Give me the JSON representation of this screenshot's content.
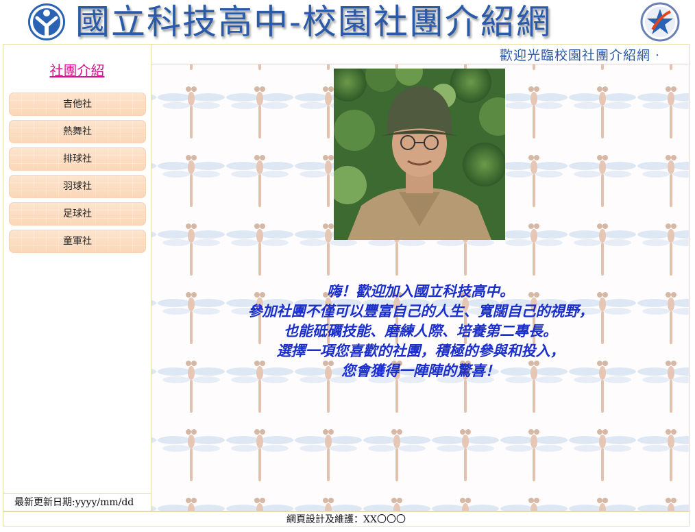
{
  "header": {
    "title": "國立科技高中-校園社團介紹網"
  },
  "welcome": {
    "marquee": "歡迎光臨校園社團介紹網 ·"
  },
  "sidebar": {
    "title": "社團介紹",
    "clubs": [
      {
        "label": "吉他社"
      },
      {
        "label": "熱舞社"
      },
      {
        "label": "排球社"
      },
      {
        "label": "羽球社"
      },
      {
        "label": "足球社"
      },
      {
        "label": "童軍社"
      }
    ],
    "update_text": "最新更新日期:yyyy/mm/dd"
  },
  "content": {
    "message_lines": [
      "嗨！歡迎加入國立科技高中。",
      "參加社團不僅可以豐富自己的人生、寬闊自己的視野，",
      "也能砥礪技能、磨練人際、培養第二專長。",
      "選擇一項您喜歡的社團，積極的參與和投入，",
      "您會獲得一陣陣的驚喜！"
    ]
  },
  "footer": {
    "credit": "網頁設計及維護：XX〇〇〇"
  },
  "colors": {
    "title_blue": "#2a5aa8",
    "link_magenta": "#d6148f",
    "message_blue": "#1a2ecc",
    "border": "#e6dca6",
    "button_peach": "#fbd6b6"
  },
  "icons": {
    "left_logo": "school-emblem-icon",
    "right_logo": "star-emblem-icon"
  }
}
